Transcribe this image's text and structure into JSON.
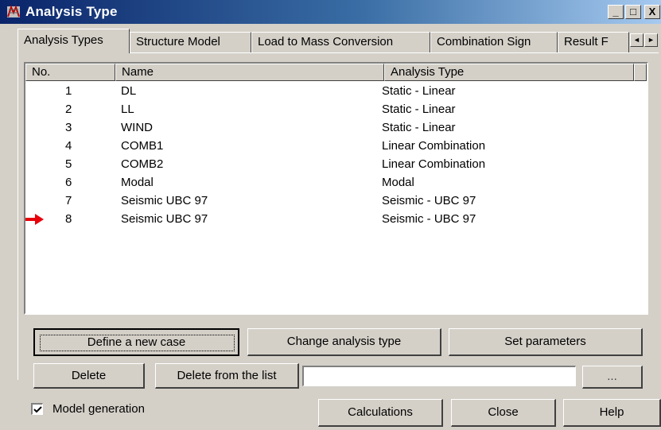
{
  "window": {
    "title": "Analysis Type",
    "min_glyph": "_",
    "max_glyph": "□",
    "close_glyph": "X"
  },
  "tabs": [
    {
      "label": "Analysis Types",
      "active": true
    },
    {
      "label": "Structure Model",
      "active": false
    },
    {
      "label": "Load to Mass Conversion",
      "active": false
    },
    {
      "label": "Combination Sign",
      "active": false
    },
    {
      "label": "Result F",
      "active": false
    }
  ],
  "tab_scroll": {
    "left": "◄",
    "right": "►"
  },
  "table": {
    "headers": {
      "no": "No.",
      "name": "Name",
      "analysis_type": "Analysis Type"
    },
    "rows": [
      {
        "no": "1",
        "name": "DL",
        "type": "Static - Linear"
      },
      {
        "no": "2",
        "name": "LL",
        "type": "Static - Linear"
      },
      {
        "no": "3",
        "name": "WIND",
        "type": "Static - Linear"
      },
      {
        "no": "4",
        "name": "COMB1",
        "type": "Linear Combination"
      },
      {
        "no": "5",
        "name": "COMB2",
        "type": "Linear Combination"
      },
      {
        "no": "6",
        "name": "Modal",
        "type": "Modal"
      },
      {
        "no": "7",
        "name": "Seismic UBC 97",
        "type": "Seismic - UBC 97"
      },
      {
        "no": "8",
        "name": "Seismic UBC 97",
        "type": "Seismic - UBC 97"
      }
    ],
    "pointer_row": 8,
    "pointer_color": "#e8000b"
  },
  "buttons": {
    "define_new_case": "Define a new case",
    "change_analysis_type": "Change analysis type",
    "set_parameters": "Set parameters",
    "delete": "Delete",
    "delete_from_list": "Delete from the list",
    "ellipsis": "...",
    "calculations": "Calculations",
    "close": "Close",
    "help": "Help"
  },
  "list_input": {
    "value": ""
  },
  "model_generation": {
    "label": "Model generation",
    "checked": true
  }
}
